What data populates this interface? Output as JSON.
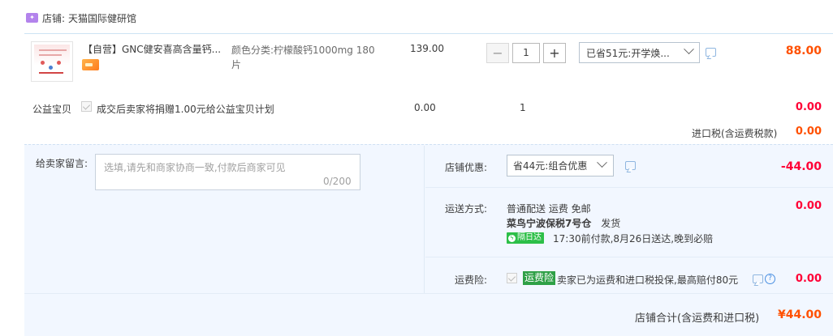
{
  "shop": {
    "icon_text": "tmall",
    "prefix": "店铺:",
    "name": "天猫国际健研馆"
  },
  "product": {
    "title": "【自营】GNC健安喜高含量钙...",
    "sku": "颜色分类:柠檬酸钙1000mg 180片",
    "unit_price": "139.00",
    "quantity": "1",
    "promo_selected": "已省51元:开学焕...",
    "total": "88.00"
  },
  "charity": {
    "label": "公益宝贝",
    "text": "成交后卖家将捐赠1.00元给公益宝贝计划",
    "price": "0.00",
    "quantity": "1",
    "total": "0.00"
  },
  "import_tax": {
    "label": "进口税(含运费税款)",
    "value": "0.00"
  },
  "message": {
    "label": "给卖家留言:",
    "placeholder": "选填,请先和商家协商一致,付款后商家可见",
    "counter": "0/200"
  },
  "store_discount": {
    "label": "店铺优惠:",
    "selected": "省44元:组合优惠",
    "value": "-44.00"
  },
  "shipping": {
    "label": "运送方式:",
    "method": "普通配送 运费 免邮",
    "warehouse": "菜鸟宁波保税7号仓",
    "dispatch": "发货",
    "badge": "隔日达",
    "delivery_note": "17:30前付款,8月26日送达,晚到必赔",
    "value": "0.00"
  },
  "insurance": {
    "label": "运费险:",
    "tag": "运费险",
    "text": "卖家已为运费和进口税投保,最高赔付80元",
    "value": "0.00"
  },
  "store_total": {
    "label": "店铺合计(含运费和进口税)",
    "value": "¥44.00"
  },
  "colors": {
    "accent_orange": "#ff5000",
    "accent_red": "#ff0036",
    "panel_bg": "#f2f7ff",
    "badge_green": "#2dbf48"
  }
}
